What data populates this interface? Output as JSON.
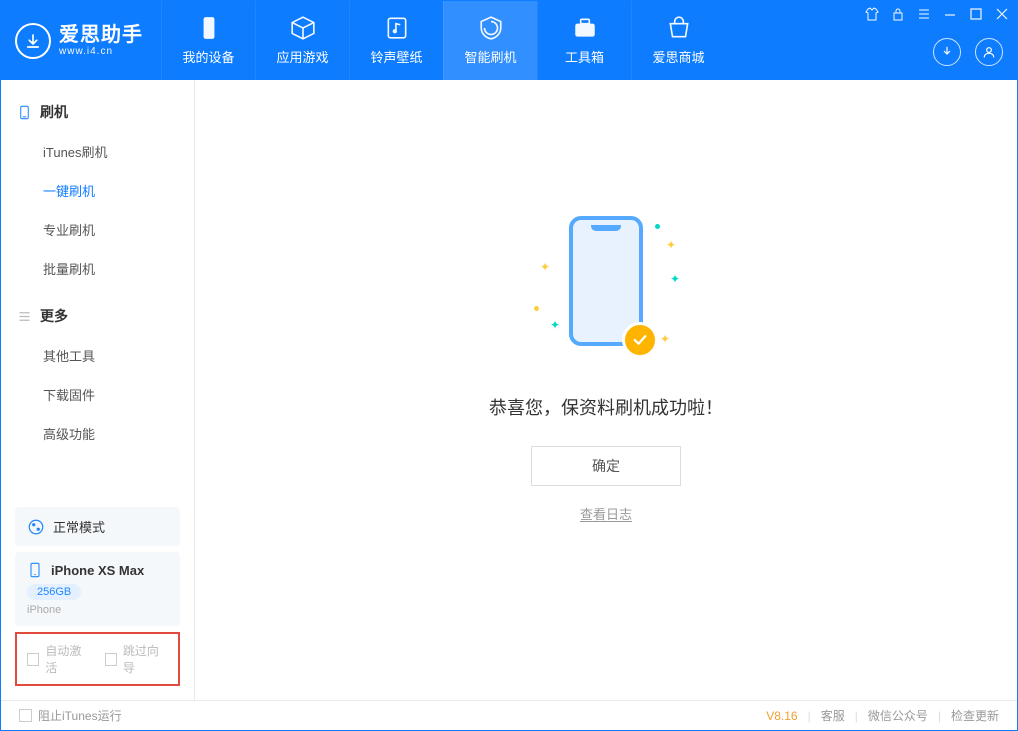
{
  "app": {
    "name": "爱思助手",
    "domain": "www.i4.cn"
  },
  "nav": {
    "tabs": [
      {
        "label": "我的设备"
      },
      {
        "label": "应用游戏"
      },
      {
        "label": "铃声壁纸"
      },
      {
        "label": "智能刷机"
      },
      {
        "label": "工具箱"
      },
      {
        "label": "爱思商城"
      }
    ]
  },
  "sidebar": {
    "group1": {
      "title": "刷机",
      "items": [
        "iTunes刷机",
        "一键刷机",
        "专业刷机",
        "批量刷机"
      ]
    },
    "group2": {
      "title": "更多",
      "items": [
        "其他工具",
        "下载固件",
        "高级功能"
      ]
    },
    "mode_label": "正常模式",
    "device": {
      "name": "iPhone XS Max",
      "storage": "256GB",
      "type": "iPhone"
    },
    "checks": {
      "auto_activate": "自动激活",
      "skip_guide": "跳过向导"
    }
  },
  "main": {
    "success_msg": "恭喜您，保资料刷机成功啦！",
    "ok_btn": "确定",
    "view_log": "查看日志"
  },
  "footer": {
    "prevent_itunes": "阻止iTunes运行",
    "version": "V8.16",
    "links": [
      "客服",
      "微信公众号",
      "检查更新"
    ]
  }
}
